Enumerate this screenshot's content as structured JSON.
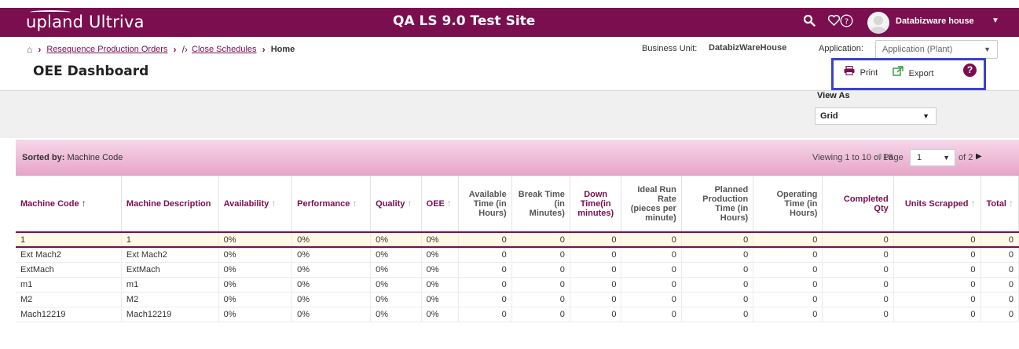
{
  "header": {
    "logo_text": "upland Ultriva",
    "site_title": "QA LS 9.0 Test Site",
    "user_name": "Databizware house"
  },
  "breadcrumb": {
    "items": [
      "Resequence Production Orders",
      "Close Schedules"
    ],
    "current": "Home"
  },
  "page_title": "OEE Dashboard",
  "business_unit": {
    "label": "Business Unit:",
    "value": "DatabizWareHouse"
  },
  "application": {
    "label": "Application:",
    "value": "Application (Plant)"
  },
  "tools": {
    "print_label": "Print",
    "export_label": "Export"
  },
  "view_as": {
    "label": "View As",
    "value": "Grid"
  },
  "grid": {
    "sorted_by_label": "Sorted by:",
    "sorted_by_value": "Machine Code",
    "viewing": "Viewing 1 to 10 of 18",
    "page_label": "Page",
    "page_value": "1",
    "of_pages": "of 2",
    "columns": [
      "Machine Code",
      "Machine Description",
      "Availability",
      "Performance",
      "Quality",
      "OEE",
      "Available Time (in Hours)",
      "Break Time (in Minutes)",
      "Down Time(in minutes)",
      "Ideal Run Rate (pieces per minute)",
      "Planned Production Time (in Hours)",
      "Operating Time (in Hours)",
      "Completed Qty",
      "Units Scrapped",
      "Total"
    ],
    "rows": [
      [
        "1",
        "1",
        "0%",
        "0%",
        "0%",
        "0%",
        "0",
        "0",
        "0",
        "0",
        "0",
        "0",
        "0",
        "0",
        "0"
      ],
      [
        "Ext Mach2",
        "Ext Mach2",
        "0%",
        "0%",
        "0%",
        "0%",
        "0",
        "0",
        "0",
        "0",
        "0",
        "0",
        "0",
        "0",
        "0"
      ],
      [
        "ExtMach",
        "ExtMach",
        "0%",
        "0%",
        "0%",
        "0%",
        "0",
        "0",
        "0",
        "0",
        "0",
        "0",
        "0",
        "0",
        "0"
      ],
      [
        "m1",
        "m1",
        "0%",
        "0%",
        "0%",
        "0%",
        "0",
        "0",
        "0",
        "0",
        "0",
        "0",
        "0",
        "0",
        "0"
      ],
      [
        "M2",
        "M2",
        "0%",
        "0%",
        "0%",
        "0%",
        "0",
        "0",
        "0",
        "0",
        "0",
        "0",
        "0",
        "0",
        "0"
      ],
      [
        "Mach12219",
        "Mach12219",
        "0%",
        "0%",
        "0%",
        "0%",
        "0",
        "0",
        "0",
        "0",
        "0",
        "0",
        "0",
        "0",
        "0"
      ]
    ]
  },
  "colors": {
    "brand": "#7a0e4f",
    "highlight_box": "#3b43c8",
    "grid_header_gradient_top": "#f7d7ea",
    "grid_header_gradient_bottom": "#e6a5c8"
  },
  "icons": {
    "search": "search-icon",
    "favorites": "heart-icon",
    "help": "question-circle-icon",
    "print": "printer-icon",
    "export": "external-link-icon",
    "home": "home-icon"
  }
}
